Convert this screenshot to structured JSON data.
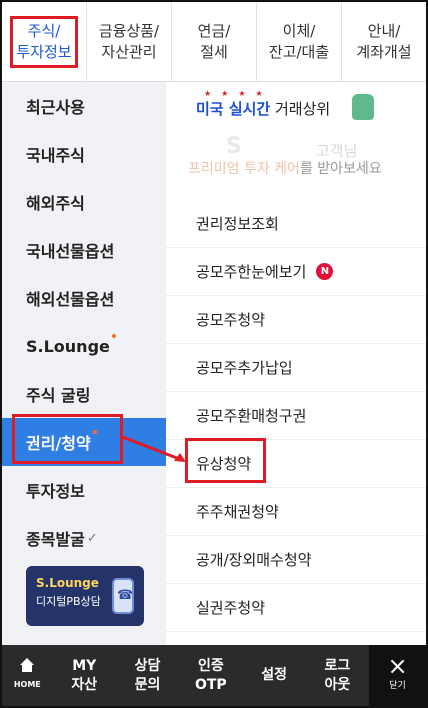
{
  "tabs": [
    {
      "label": "주식/\n투자정보",
      "active": true
    },
    {
      "label": "금융상품/\n자산관리",
      "active": false
    },
    {
      "label": "연금/\n절세",
      "active": false
    },
    {
      "label": "이체/\n잔고/대출",
      "active": false
    },
    {
      "label": "안내/\n계좌개설",
      "active": false
    }
  ],
  "sidebar": {
    "items": [
      {
        "label": "최근사용"
      },
      {
        "label": "국내주식"
      },
      {
        "label": "해외주식"
      },
      {
        "label": "국내선물옵션"
      },
      {
        "label": "해외선물옵션"
      },
      {
        "label": "S.Lounge"
      },
      {
        "label": "주식 굴링"
      },
      {
        "label": "권리/청약"
      },
      {
        "label": "투자정보"
      },
      {
        "label": "종목발굴"
      }
    ],
    "banner": {
      "title": "S.Lounge",
      "subtitle": "디지털PB상담"
    }
  },
  "promo": {
    "hot_prefix": "미국 실시간",
    "hot_suffix": " 거래상위",
    "faded_text": "S",
    "faded_text2": "고객님",
    "subtitle_a": "프리미엄 투자 케어",
    "subtitle_b": "를 받아보세요"
  },
  "menu": {
    "items": [
      {
        "label": "권리정보조회"
      },
      {
        "label": "공모주한눈에보기",
        "badge": "N"
      },
      {
        "label": "공모주청약"
      },
      {
        "label": "공모주추가납입"
      },
      {
        "label": "공모주환매청구권"
      },
      {
        "label": "유상청약"
      },
      {
        "label": "주주채권청약"
      },
      {
        "label": "공개/장외매수청약"
      },
      {
        "label": "실권주청약"
      }
    ]
  },
  "bottombar": {
    "home": "HOME",
    "items": [
      "MY\n자산",
      "상담\n문의",
      "인증\nOTP",
      "설정",
      "로그\n아웃"
    ],
    "close": "닫기",
    "close_symbol": "×"
  },
  "colors": {
    "accent": "#2f7ee4",
    "highlight": "#e01b24",
    "bottom_bar": "#2b2b2b"
  }
}
